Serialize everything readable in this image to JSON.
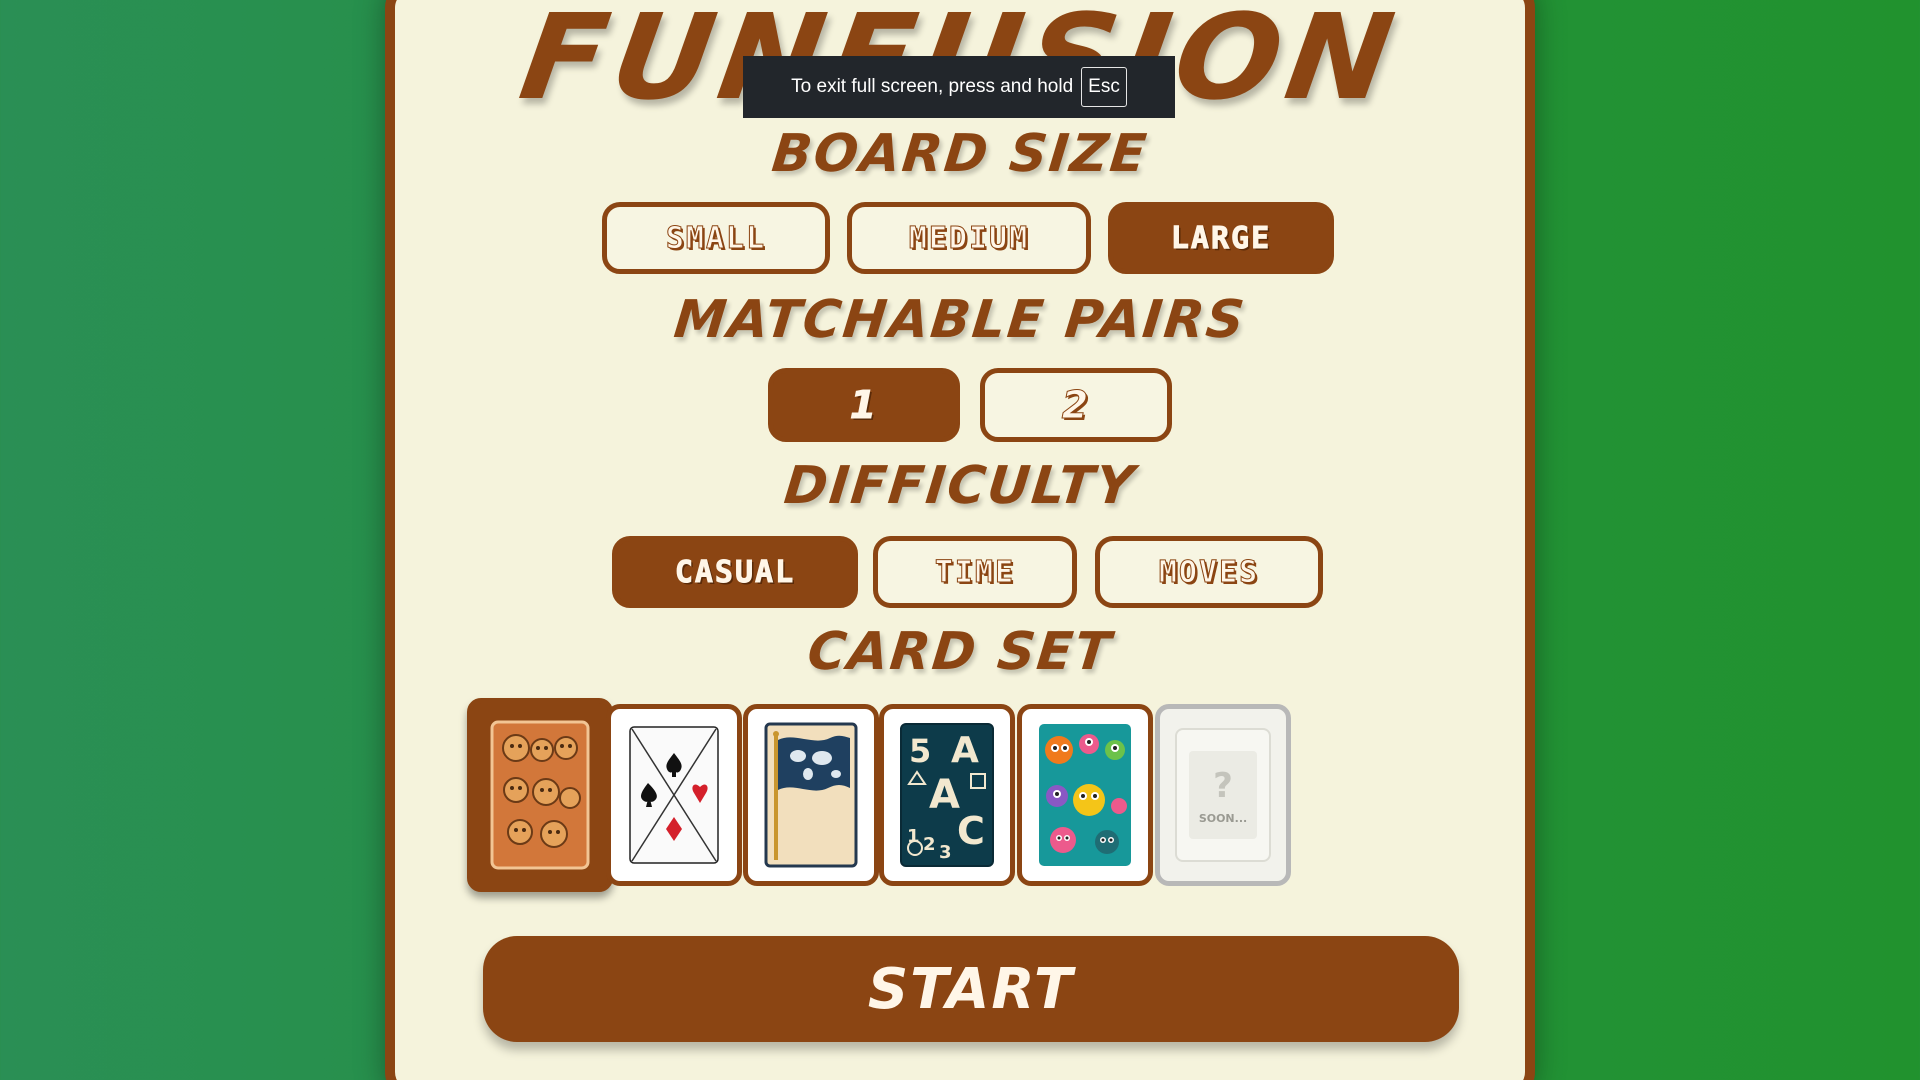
{
  "app": {
    "title": "FUNFUSION"
  },
  "fullscreen_toast": {
    "text": "To exit full screen, press and hold",
    "key": "Esc"
  },
  "board_size": {
    "heading": "BOARD SIZE",
    "options": [
      "SMALL",
      "MEDIUM",
      "LARGE"
    ],
    "selected": "LARGE"
  },
  "matchable_pairs": {
    "heading": "MATCHABLE PAIRS",
    "options": [
      "1",
      "2"
    ],
    "selected": "1"
  },
  "difficulty": {
    "heading": "DIFFICULTY",
    "options": [
      "CASUAL",
      "TIME",
      "MOVES"
    ],
    "selected": "CASUAL"
  },
  "card_set": {
    "heading": "CARD SET",
    "sets": [
      {
        "name": "animals",
        "icon": "animal-faces-icon",
        "selected": true
      },
      {
        "name": "playing cards",
        "icon": "card-suits-icon",
        "selected": false
      },
      {
        "name": "world flag",
        "icon": "world-flag-icon",
        "selected": false
      },
      {
        "name": "letters and numbers",
        "icon": "abc-123-icon",
        "selected": false
      },
      {
        "name": "monsters",
        "icon": "monsters-icon",
        "selected": false
      },
      {
        "name": "coming soon",
        "icon": "question-mark-icon",
        "selected": false,
        "label": "SOON..."
      }
    ]
  },
  "start_button": {
    "label": "START"
  },
  "colors": {
    "primary": "#8b4513",
    "panel_bg": "#f5f3dc",
    "page_bg": "#23923f",
    "text_light": "#fff6e8"
  }
}
